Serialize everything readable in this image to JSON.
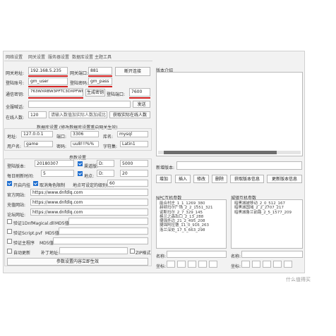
{
  "tabs": [
    "网络设置",
    "网关设置",
    "服务器设置",
    "数据库设置",
    "主题工具"
  ],
  "conn": {
    "gateway_ip_label": "网关地址:",
    "gateway_ip": "192.168.5.235",
    "port_label": "网关端口:",
    "port": "881",
    "connect_button": "断开连接",
    "account_label": "登陆账号:",
    "account": "gm_user",
    "password_label": "登陆密码:",
    "password": "gm_pass",
    "secret_label": "通信密钥:",
    "secret": "763WXRBW3PFTC3DXPFWH",
    "gen_secret_button": "生成密钥",
    "server_port_label": "登陆端口:",
    "server_port": "7600",
    "broadcast_label": "全服喊话:",
    "broadcast_button": "发送",
    "online_label": "在线人数:",
    "online_count": "120",
    "online_placeholder": "请输入数值加实际人数加成比",
    "get_online_button": "获取实际在线人数"
  },
  "db": {
    "section_title": "数据库设置 (修改数据库设置重启网关生效)",
    "addr_label": "地址:",
    "addr": "127.0.0.1",
    "port_label": "端口:",
    "port": "3306",
    "name_label": "库名:",
    "name": "mysql",
    "user_label": "用户名:",
    "user": "game",
    "pass_label": "密码:",
    "pass": "uu8!!!%%",
    "charset_label": "字符集:",
    "charset": "Latin1"
  },
  "params": {
    "section_title": "参数设置",
    "version_label": "登陆版本:",
    "version": "20180307",
    "channel_label": "渠道版:",
    "channel": "D:",
    "channel_value": "5000",
    "refresh_label": "每日刷新时间:",
    "refresh": "5",
    "point_label": "地点:",
    "point": "D:",
    "point_value": "20",
    "open_inner_label": "开启内挂",
    "close_role_label": "取消角色限制",
    "max_level_label": "地点可设定的级别(积)",
    "max_level": "60",
    "website_label": "官方网站:",
    "website": "https://www.dnfdlq.com",
    "recharge_label": "充值网站:",
    "recharge": "https://www.dnfdlq.com",
    "forum_label": "论坛网址:",
    "forum": "https://www.dnfdlq.com",
    "dll_label": "验证1DnfMagical.dll",
    "md5_label": "MD5值:",
    "pvf_label": "验证Script.pvf",
    "md5b_label": "MD5值:",
    "client_label": "验证主程序",
    "md5c_label": "MD5值:",
    "auto_update_label": "自动更新",
    "auto_update_url_label": "补丁地址:",
    "zip_label": "ZIP格式",
    "save_button": "参数设置内容立即生效"
  },
  "right": {
    "version_intro_label": "版本介绍",
    "new_version_label": "新增版本:",
    "buttons": [
      "增加",
      "插入",
      "修改",
      "删除",
      "获取版本信息",
      "更新版本信息"
    ],
    "npc_title": "NPC互机参数",
    "npc_list": [
      "能合村庄_1_1_1269_380",
      "赫顿玛尔广场_2_2_1551_321",
      "诺斯玛尔_2_7_329_145",
      "格兰之森出口_2_13_288",
      "捷锦外边_21_2_495_208",
      "捷锦阿拉德_11_0_916_263",
      "洛兰深处_17_5_663_298"
    ],
    "field_title": "城镇互机参数",
    "field_list": [
      "暗黑城被移动_2_0_512_167",
      "暗黑城国域_2_2_2707_217",
      "暗黑城鲁兰前路_2_5_1577_209"
    ],
    "name_label": "名称:",
    "coord_label": "坐标:",
    "name_label2": "名称:",
    "coord_label2": "坐标:"
  },
  "watermark": "什么值得买"
}
